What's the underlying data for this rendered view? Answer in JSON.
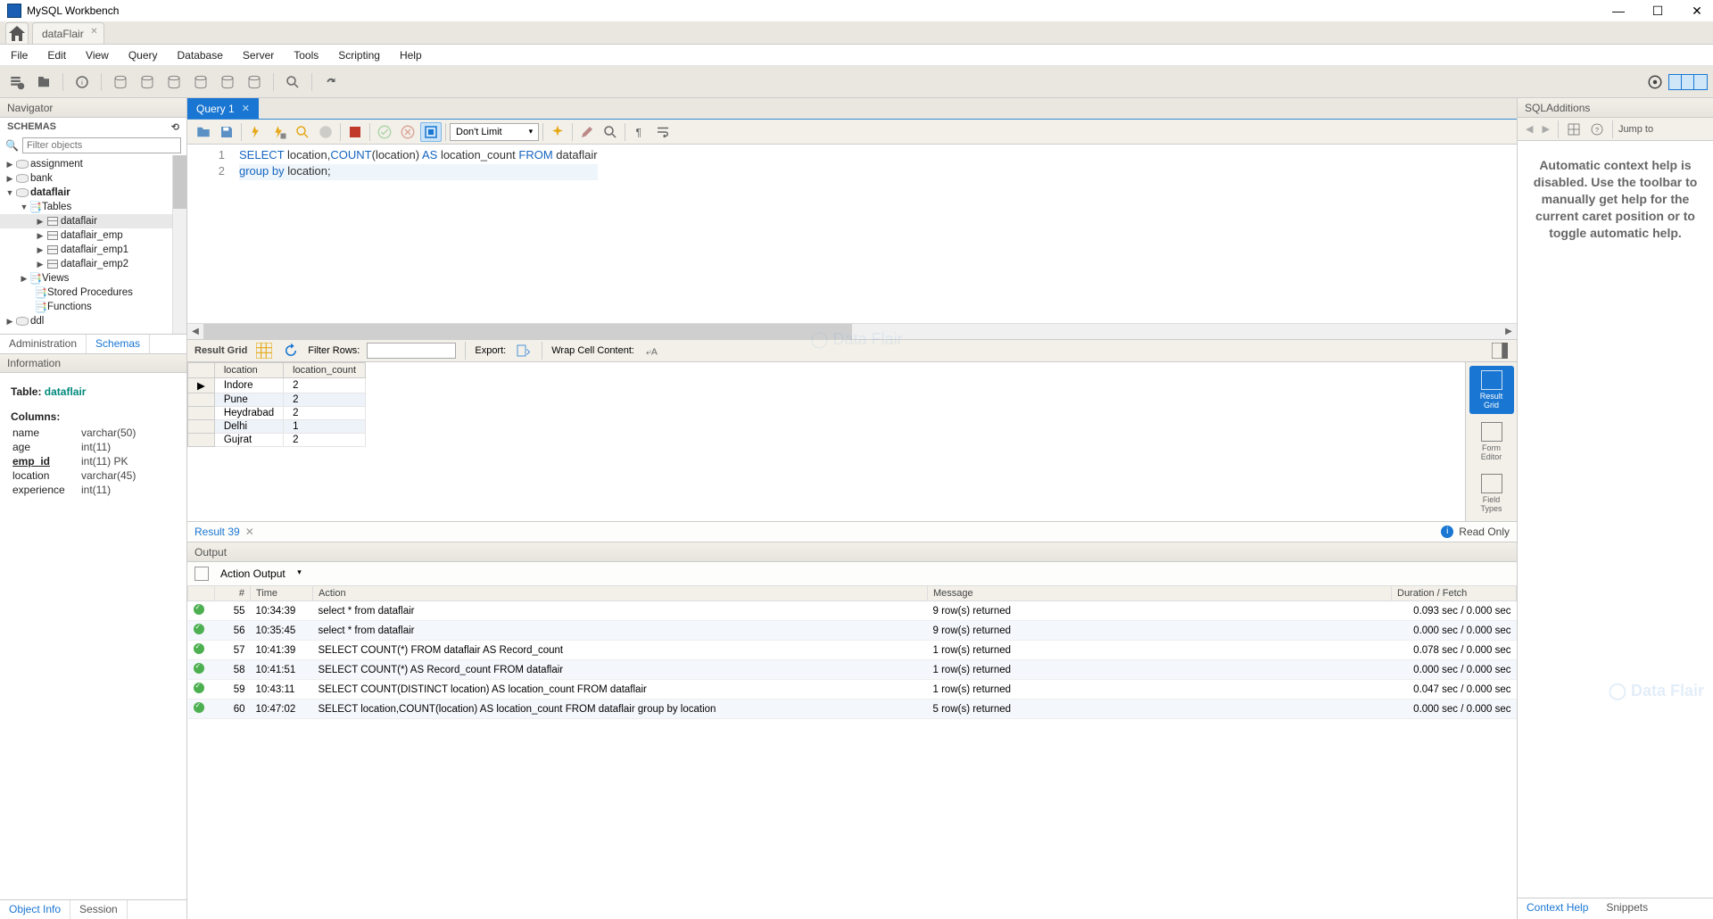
{
  "app": {
    "title": "MySQL Workbench"
  },
  "connection_tab": {
    "name": "dataFlair"
  },
  "menu": [
    "File",
    "Edit",
    "View",
    "Query",
    "Database",
    "Server",
    "Tools",
    "Scripting",
    "Help"
  ],
  "navigator": {
    "title": "Navigator",
    "schemas_label": "SCHEMAS",
    "filter_placeholder": "Filter objects",
    "tabs": {
      "admin": "Administration",
      "schemas": "Schemas"
    },
    "tree": {
      "assignment": "assignment",
      "bank": "bank",
      "dataflair": "dataflair",
      "tables": "Tables",
      "t1": "dataflair",
      "t2": "dataflair_emp",
      "t3": "dataflair_emp1",
      "t4": "dataflair_emp2",
      "views": "Views",
      "sp": "Stored Procedures",
      "fn": "Functions",
      "ddl": "ddl"
    }
  },
  "information": {
    "title": "Information",
    "table_label": "Table: ",
    "table_name": "dataflair",
    "columns_label": "Columns:",
    "columns": [
      {
        "name": "name",
        "type": "varchar(50)"
      },
      {
        "name": "age",
        "type": "int(11)"
      },
      {
        "name": "emp_id",
        "type": "int(11) PK",
        "pk": true
      },
      {
        "name": "location",
        "type": "varchar(45)"
      },
      {
        "name": "experience",
        "type": "int(11)"
      }
    ],
    "tabs": {
      "object": "Object Info",
      "session": "Session"
    }
  },
  "query_tab": {
    "label": "Query 1"
  },
  "editor_toolbar": {
    "limit_value": "Don't Limit"
  },
  "sql_lines": [
    {
      "n": "1",
      "tokens": [
        {
          "t": "SELECT",
          "c": "kw"
        },
        {
          "t": " location,",
          "c": "ident"
        },
        {
          "t": "COUNT",
          "c": "fn"
        },
        {
          "t": "(location) ",
          "c": "ident"
        },
        {
          "t": "AS",
          "c": "kw"
        },
        {
          "t": " location_count ",
          "c": "ident"
        },
        {
          "t": "FROM",
          "c": "kw"
        },
        {
          "t": " dataflair",
          "c": "ident"
        }
      ]
    },
    {
      "n": "2",
      "tokens": [
        {
          "t": "group by",
          "c": "kw"
        },
        {
          "t": " location;",
          "c": "ident"
        }
      ]
    }
  ],
  "result_bar": {
    "label": "Result Grid",
    "filter_label": "Filter Rows:",
    "export_label": "Export:",
    "wrap_label": "Wrap Cell Content:"
  },
  "result": {
    "headers": [
      "location",
      "location_count"
    ],
    "rows": [
      [
        "Indore",
        "2"
      ],
      [
        "Pune",
        "2"
      ],
      [
        "Heydrabad",
        "2"
      ],
      [
        "Delhi",
        "1"
      ],
      [
        "Gujrat",
        "2"
      ]
    ]
  },
  "side_tabs": {
    "grid": "Result\nGrid",
    "form": "Form\nEditor",
    "types": "Field\nTypes"
  },
  "result_tab": {
    "label": "Result 39",
    "readonly": "Read Only"
  },
  "output": {
    "title": "Output",
    "selector": "Action Output",
    "headers": {
      "n": "#",
      "time": "Time",
      "action": "Action",
      "message": "Message",
      "dur": "Duration / Fetch"
    },
    "rows": [
      {
        "n": "55",
        "time": "10:34:39",
        "action": "select * from dataflair",
        "msg": "9 row(s) returned",
        "dur": "0.093 sec / 0.000 sec"
      },
      {
        "n": "56",
        "time": "10:35:45",
        "action": "select * from dataflair",
        "msg": "9 row(s) returned",
        "dur": "0.000 sec / 0.000 sec"
      },
      {
        "n": "57",
        "time": "10:41:39",
        "action": "SELECT COUNT(*) FROM dataflair AS Record_count",
        "msg": "1 row(s) returned",
        "dur": "0.078 sec / 0.000 sec"
      },
      {
        "n": "58",
        "time": "10:41:51",
        "action": "SELECT COUNT(*) AS Record_count FROM dataflair",
        "msg": "1 row(s) returned",
        "dur": "0.000 sec / 0.000 sec"
      },
      {
        "n": "59",
        "time": "10:43:11",
        "action": "SELECT COUNT(DISTINCT location) AS location_count FROM dataflair",
        "msg": "1 row(s) returned",
        "dur": "0.047 sec / 0.000 sec"
      },
      {
        "n": "60",
        "time": "10:47:02",
        "action": "SELECT location,COUNT(location) AS location_count FROM dataflair  group by location",
        "msg": "5 row(s) returned",
        "dur": "0.000 sec / 0.000 sec"
      }
    ]
  },
  "sql_additions": {
    "title": "SQLAdditions",
    "jump_label": "Jump to",
    "help_text": "Automatic context help is disabled. Use the toolbar to manually get help for the current caret position or to toggle automatic help.",
    "tabs": {
      "context": "Context Help",
      "snippets": "Snippets"
    }
  }
}
